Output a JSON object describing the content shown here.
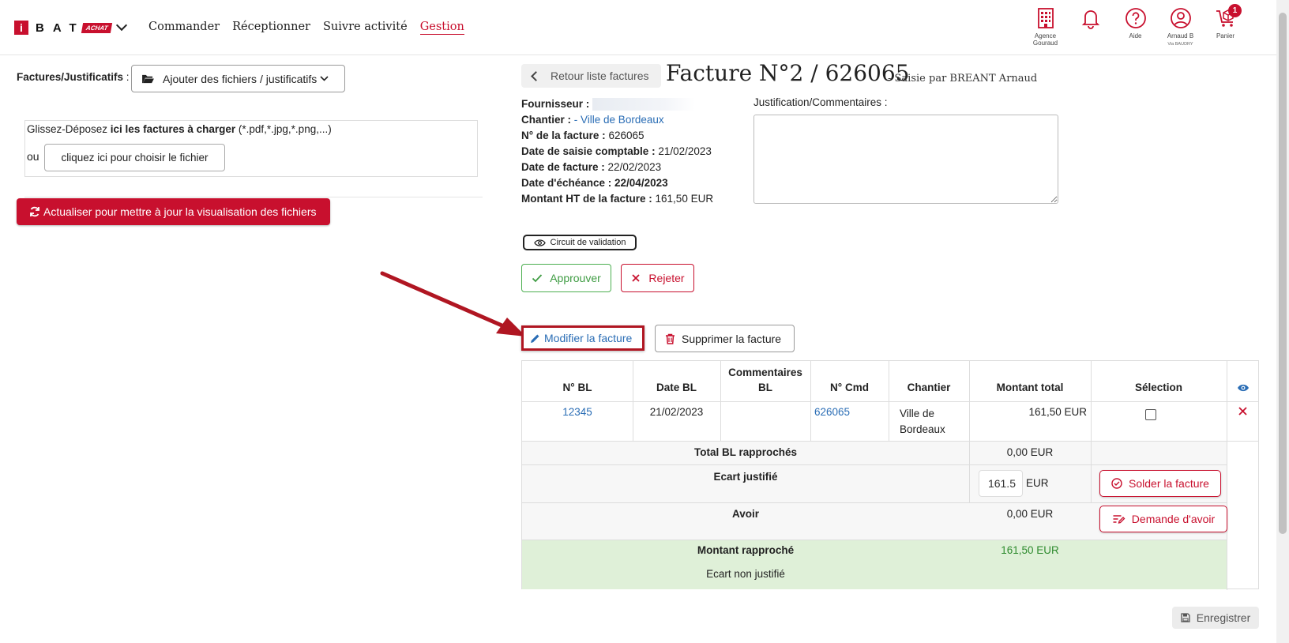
{
  "brand": {
    "letters": "BAT",
    "initial": "i",
    "badge": "ACHAT"
  },
  "nav": {
    "items": [
      "Commander",
      "Réceptionner",
      "Suivre activité",
      "Gestion"
    ]
  },
  "navicons": {
    "agency": {
      "label1": "Agence",
      "label2": "Gouraud"
    },
    "notifications": {
      "label": ""
    },
    "help": {
      "label": "Aide"
    },
    "user": {
      "label1": "Arnaud B",
      "label2": "Via BAUDRY"
    },
    "cart": {
      "label": "Panier",
      "count": "1"
    }
  },
  "left": {
    "label": "Factures/Justificatifs",
    "label_colon": " :",
    "add_files_button": "Ajouter des fichiers / justificatifs",
    "dropzone_prefix": "Glissez-Déposez ",
    "dropzone_bold": "ici les factures à charger",
    "dropzone_suffix": " (*.pdf,*.jpg,*.png,...)",
    "or": "ou",
    "choose_button": "cliquez ici pour choisir le fichier",
    "refresh_button": "Actualiser pour mettre à jour la visualisation des fichiers"
  },
  "invoice": {
    "back_button": "Retour liste factures",
    "title": "Facture N°2 / 626065",
    "subtitle": "- Saisie par BREANT Arnaud",
    "fournisseur_label": "Fournisseur :",
    "chantier_label": "Chantier :",
    "chantier_value": "- Ville de Bordeaux",
    "numero_label": "N° de la facture :",
    "numero_value": "626065",
    "saisie_label": "Date de saisie comptable :",
    "saisie_value": "21/02/2023",
    "date_label": "Date de facture :",
    "date_value": "22/02/2023",
    "echeance_label": "Date d'échéance :",
    "echeance_value": "22/04/2023",
    "montant_label": "Montant HT de la facture :",
    "montant_value": "161,50 EUR",
    "comment_label": "Justification/Commentaires :",
    "comment_value": ""
  },
  "actions": {
    "circuit": "Circuit de validation",
    "approve": "Approuver",
    "reject": "Rejeter",
    "modify": "Modifier la facture",
    "delete": "Supprimer la facture",
    "save": "Enregistrer"
  },
  "table": {
    "headers": {
      "bl": "N° BL",
      "date": "Date BL",
      "comment1": "Commentaires",
      "comment2": "BL",
      "cmd": "N° Cmd",
      "chantier": "Chantier",
      "montant": "Montant total",
      "selection": "Sélection"
    },
    "row": {
      "bl": "12345",
      "date": "21/02/2023",
      "comment": "",
      "cmd": "626065",
      "chantier1": "Ville de",
      "chantier2": "Bordeaux",
      "montant": "161,50 EUR",
      "selected": false
    },
    "total_label": "Total BL rapprochés",
    "total_value": "0,00 EUR",
    "ecart_label": "Ecart justifié",
    "ecart_value": "161.5",
    "ecart_unit": "EUR",
    "solder_button": "Solder la facture",
    "avoir_label": "Avoir",
    "avoir_value": "0,00 EUR",
    "avoir_button": "Demande d'avoir",
    "rapproche_label": "Montant rapproché",
    "rapproche_value": "161,50 EUR",
    "non_justifie_label": "Ecart non justifié"
  },
  "colors": {
    "brand": "#c8102e",
    "link": "#2a6db5",
    "success": "#3f9c43",
    "highlight_row": "#dff0d8"
  }
}
